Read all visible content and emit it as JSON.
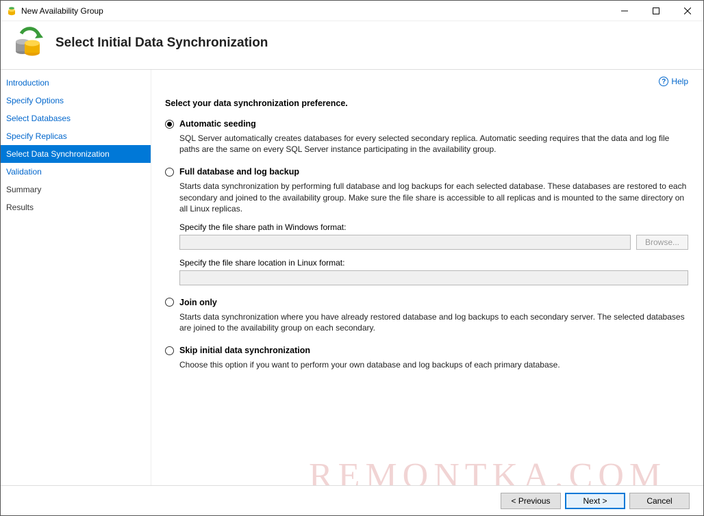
{
  "window": {
    "title": "New Availability Group"
  },
  "header": {
    "title": "Select Initial Data Synchronization"
  },
  "sidebar": {
    "items": [
      {
        "label": "Introduction",
        "state": "link"
      },
      {
        "label": "Specify Options",
        "state": "link"
      },
      {
        "label": "Select Databases",
        "state": "link"
      },
      {
        "label": "Specify Replicas",
        "state": "link"
      },
      {
        "label": "Select Data Synchronization",
        "state": "active"
      },
      {
        "label": "Validation",
        "state": "link"
      },
      {
        "label": "Summary",
        "state": "disabled"
      },
      {
        "label": "Results",
        "state": "disabled"
      }
    ]
  },
  "help": {
    "label": "Help"
  },
  "content": {
    "intro": "Select your data synchronization preference.",
    "options": [
      {
        "id": "automatic-seeding",
        "title": "Automatic seeding",
        "selected": true,
        "description": "SQL Server automatically creates databases for every selected secondary replica. Automatic seeding requires that the data and log file paths are the same on every SQL Server instance participating in the availability group."
      },
      {
        "id": "full-backup",
        "title": "Full database and log backup",
        "selected": false,
        "description": "Starts data synchronization by performing full database and log backups for each selected database. These databases are restored to each secondary and joined to the availability group. Make sure the file share is accessible to all replicas and is mounted to the same directory on all Linux replicas.",
        "windows_label": "Specify the file share path in Windows format:",
        "windows_value": "",
        "browse_label": "Browse...",
        "linux_label": "Specify the file share location in Linux format:",
        "linux_value": ""
      },
      {
        "id": "join-only",
        "title": "Join only",
        "selected": false,
        "description": "Starts data synchronization where you have already restored database and log backups to each secondary server. The selected databases are joined to the availability group on each secondary."
      },
      {
        "id": "skip-sync",
        "title": "Skip initial data synchronization",
        "selected": false,
        "description": "Choose this option if you want to perform your own database and log backups of each primary database."
      }
    ]
  },
  "footer": {
    "previous": "< Previous",
    "next": "Next >",
    "cancel": "Cancel"
  },
  "watermark": "REMONTKA.COM"
}
